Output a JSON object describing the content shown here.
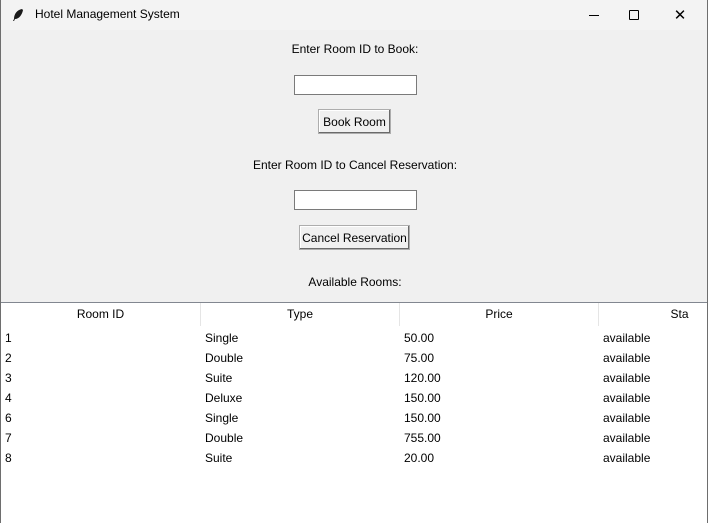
{
  "window": {
    "title": "Hotel Management System",
    "icon": "feather-icon",
    "controls": {
      "minimize": "minimize-icon",
      "maximize": "maximize-icon",
      "close": "✕"
    }
  },
  "book": {
    "label": "Enter Room ID to Book:",
    "value": "",
    "button": "Book Room"
  },
  "cancel": {
    "label": "Enter Room ID to Cancel Reservation:",
    "value": "",
    "button": "Cancel Reservation"
  },
  "rooms": {
    "label": "Available Rooms:",
    "columns": [
      "Room ID",
      "Type",
      "Price",
      "Sta"
    ],
    "rows": [
      [
        "1",
        "Single",
        "50.00",
        "available"
      ],
      [
        "2",
        "Double",
        "75.00",
        "available"
      ],
      [
        "3",
        "Suite",
        "120.00",
        "available"
      ],
      [
        "4",
        "Deluxe",
        "150.00",
        "available"
      ],
      [
        "6",
        "Single",
        "150.00",
        "available"
      ],
      [
        "7",
        "Double",
        "755.00",
        "available"
      ],
      [
        "8",
        "Suite",
        "20.00",
        "available"
      ]
    ]
  }
}
